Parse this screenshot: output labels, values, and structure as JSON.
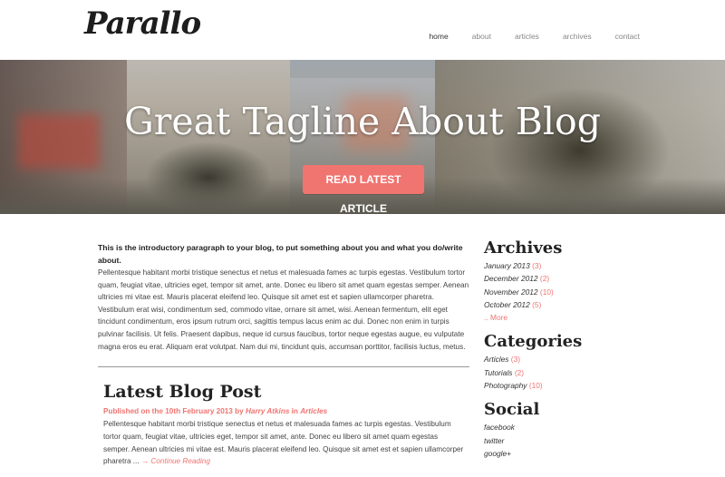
{
  "brand": {
    "logo": "Parallo"
  },
  "nav": {
    "items": [
      {
        "label": "home",
        "active": true
      },
      {
        "label": "about",
        "active": false
      },
      {
        "label": "articles",
        "active": false
      },
      {
        "label": "archives",
        "active": false
      },
      {
        "label": "contact",
        "active": false
      }
    ]
  },
  "hero": {
    "tagline": "Great Tagline About Blog",
    "cta_label": "Read Latest Article"
  },
  "intro": {
    "title": "This is the introductory paragraph to your blog, to put something about you and what you do/write about.",
    "body": "Pellentesque habitant morbi tristique senectus et netus et malesuada fames ac turpis egestas. Vestibulum tortor quam, feugiat vitae, ultricies eget, tempor sit amet, ante. Donec eu libero sit amet quam egestas semper. Aenean ultricies mi vitae est. Mauris placerat eleifend leo. Quisque sit amet est et sapien ullamcorper pharetra. Vestibulum erat wisi, condimentum sed, commodo vitae, ornare sit amet, wisi. Aenean fermentum, elit eget tincidunt condimentum, eros ipsum rutrum orci, sagittis tempus lacus enim ac dui. Donec non enim in turpis pulvinar facilisis. Ut felis. Praesent dapibus, neque id cursus faucibus, tortor neque egestas augue, eu vulputate magna eros eu erat. Aliquam erat volutpat. Nam dui mi, tincidunt quis, accumsan porttitor, facilisis luctus, metus."
  },
  "latest_post": {
    "heading": "Latest Blog Post",
    "meta_prefix": "Published on the 10th February 2013 by ",
    "author": "Harry Atkins",
    "meta_in": " in ",
    "category": "Articles",
    "excerpt": "Pellentesque habitant morbi tristique senectus et netus et malesuada fames ac turpis egestas. Vestibulum tortor quam, feugiat vitae, ultricies eget, tempor sit amet, ante. Donec eu libero sit amet quam egestas semper. Aenean ultricies mi vitae est. Mauris placerat eleifend leo. Quisque sit amet est et sapien ullamcorper pharetra ... ",
    "continue_label": "→ Continue Reading"
  },
  "sidebar": {
    "archives": {
      "heading": "Archives",
      "items": [
        {
          "label": "January 2013",
          "count": "(3)"
        },
        {
          "label": "December 2012",
          "count": "(2)"
        },
        {
          "label": "November 2012",
          "count": "(10)"
        },
        {
          "label": "October 2012",
          "count": "(5)"
        }
      ],
      "more_label": ".. More"
    },
    "categories": {
      "heading": "Categories",
      "items": [
        {
          "label": "Articles",
          "count": "(3)"
        },
        {
          "label": "Tutorials",
          "count": "(2)"
        },
        {
          "label": "Photography",
          "count": "(10)"
        }
      ]
    },
    "social": {
      "heading": "Social",
      "items": [
        {
          "label": "facebook"
        },
        {
          "label": "twitter"
        },
        {
          "label": "google+"
        }
      ]
    }
  },
  "colors": {
    "accent": "#f07470",
    "text": "#333333",
    "heading": "#222222"
  }
}
